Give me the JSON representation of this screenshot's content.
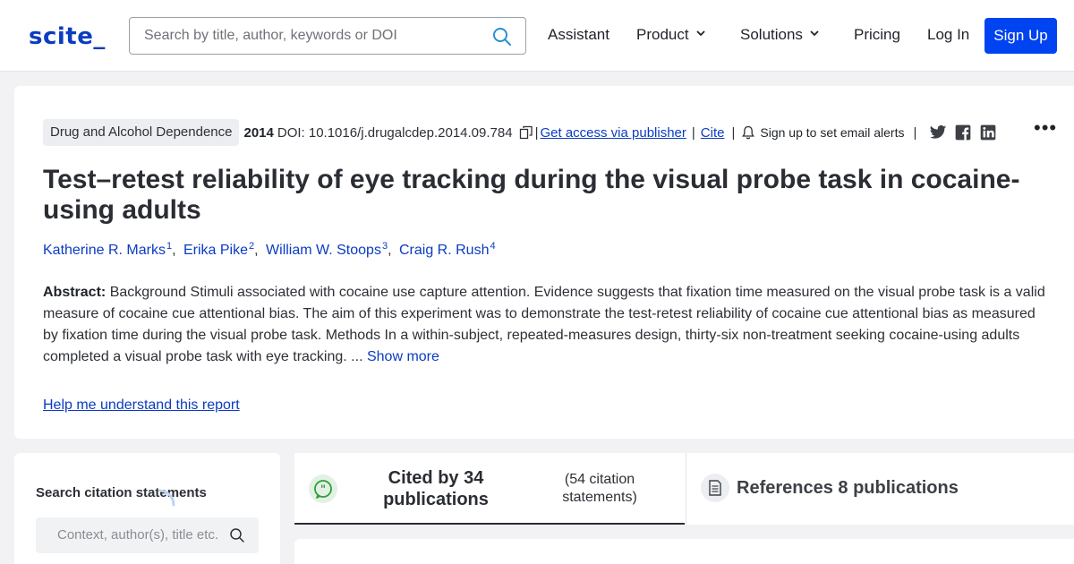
{
  "header": {
    "logo": "scite_",
    "search_placeholder": "Search by title, author, keywords or DOI",
    "nav": {
      "assistant": "Assistant",
      "product": "Product",
      "solutions": "Solutions",
      "pricing": "Pricing",
      "login": "Log In",
      "signup": "Sign Up"
    }
  },
  "paper": {
    "journal": "Drug and Alcohol Dependence",
    "year": "2014",
    "doi": "DOI: 10.1016/j.drugalcdep.2014.09.784",
    "access_link": "Get access via publisher",
    "cite_link": "Cite",
    "alert_text": "Sign up to set email alerts",
    "title": "Test–retest reliability of eye tracking during the visual probe task in cocaine-using adults",
    "authors": [
      {
        "name": "Katherine R. Marks",
        "sup": "1"
      },
      {
        "name": "Erika Pike",
        "sup": "2"
      },
      {
        "name": "William W. Stoops",
        "sup": "3"
      },
      {
        "name": "Craig R. Rush",
        "sup": "4"
      }
    ],
    "abstract_label": "Abstract:",
    "abstract_text": "Background Stimuli associated with cocaine use capture attention. Evidence suggests that fixation time measured on the visual probe task is a valid measure of cocaine cue attentional bias. The aim of this experiment was to demonstrate the test-retest reliability of cocaine cue attentional bias as measured by fixation time during the visual probe task. Methods In a within-subject, repeated-measures design, thirty-six non-treatment seeking cocaine-using adults completed a visual probe task with eye tracking. ...",
    "show_more": "Show more",
    "help_link": "Help me understand this report"
  },
  "citations": {
    "panel_title": "Search citation statements",
    "search_placeholder": "Context, author(s), title etc.",
    "tab_cited": "Cited by 34 publications",
    "tab_cited_sub": "(54 citation statements)",
    "tab_refs": "References 8 publications"
  },
  "icons": {
    "search": "search-icon",
    "copy": "copy-icon",
    "bell": "bell-icon",
    "twitter": "twitter-icon",
    "facebook": "facebook-icon",
    "linkedin": "linkedin-icon",
    "more": "more-icon",
    "quote": "quote-bubble-icon",
    "document": "document-icon"
  },
  "colors": {
    "brand": "#0b3cc1",
    "signup_bg": "#0043f0",
    "quote_icon": "#2e9e3e"
  }
}
